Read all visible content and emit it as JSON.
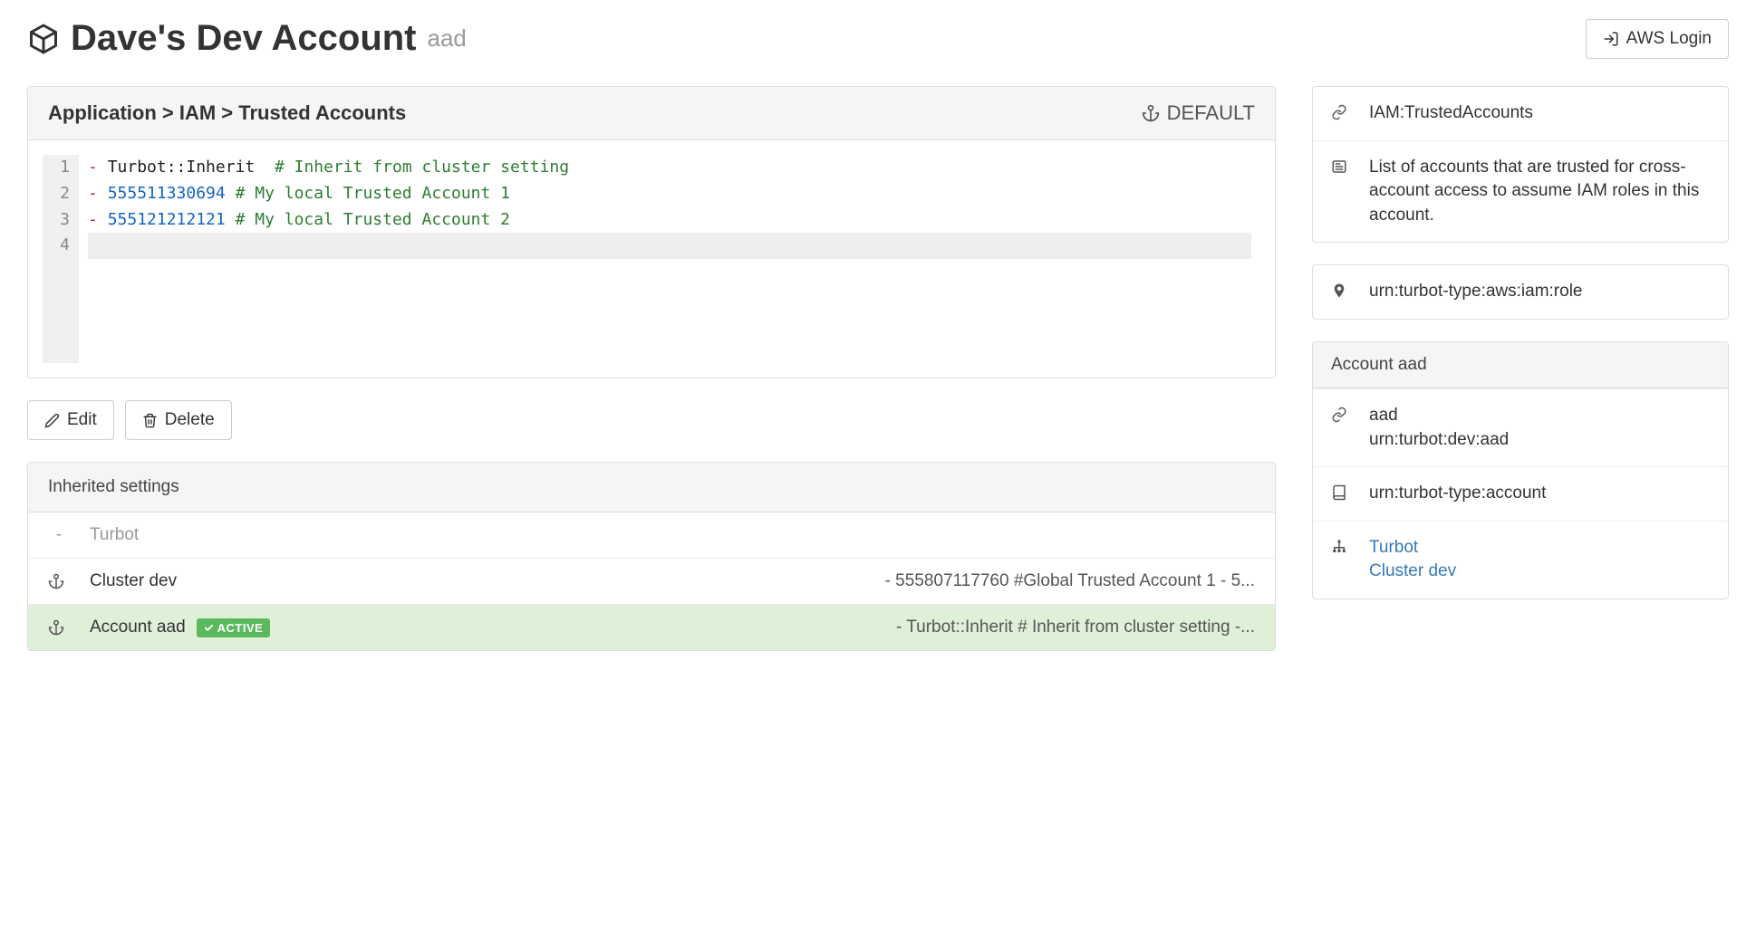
{
  "header": {
    "title": "Dave's Dev Account",
    "suffix": "aad",
    "aws_login": "AWS Login"
  },
  "setting_panel": {
    "breadcrumb": "Application > IAM > Trusted Accounts",
    "default_tag": "DEFAULT",
    "editor_lines": [
      {
        "dash": "- ",
        "ident": "Turbot::Inherit",
        "spacer": "  ",
        "comment": "# Inherit from cluster setting"
      },
      {
        "dash": "- ",
        "num": "555511330694",
        "spacer": " ",
        "comment": "# My local Trusted Account 1"
      },
      {
        "dash": "- ",
        "num": "555121212121",
        "spacer": " ",
        "comment": "# My local Trusted Account 2"
      },
      {
        "empty": true
      }
    ]
  },
  "buttons": {
    "edit": "Edit",
    "delete": "Delete"
  },
  "inherited": {
    "title": "Inherited settings",
    "rows": [
      {
        "icon": "dash",
        "name": "Turbot",
        "value": "",
        "muted": true
      },
      {
        "icon": "anchor",
        "name": "Cluster dev",
        "value": "- 555807117760 #Global Trusted Account 1 - 5..."
      },
      {
        "icon": "anchor",
        "name": "Account aad",
        "value": "- Turbot::Inherit # Inherit from cluster setting -...",
        "active": true,
        "badge": "ACTIVE"
      }
    ]
  },
  "sidebar": {
    "type_info": {
      "name": "IAM:TrustedAccounts",
      "description": "List of accounts that are trusted for cross-account access to assume IAM roles in this account."
    },
    "urn_type": "urn:turbot-type:aws:iam:role",
    "account": {
      "header": "Account aad",
      "id": "aad",
      "urn": "urn:turbot:dev:aad",
      "type_urn": "urn:turbot-type:account",
      "hierarchy": [
        "Turbot",
        "Cluster dev"
      ]
    }
  }
}
